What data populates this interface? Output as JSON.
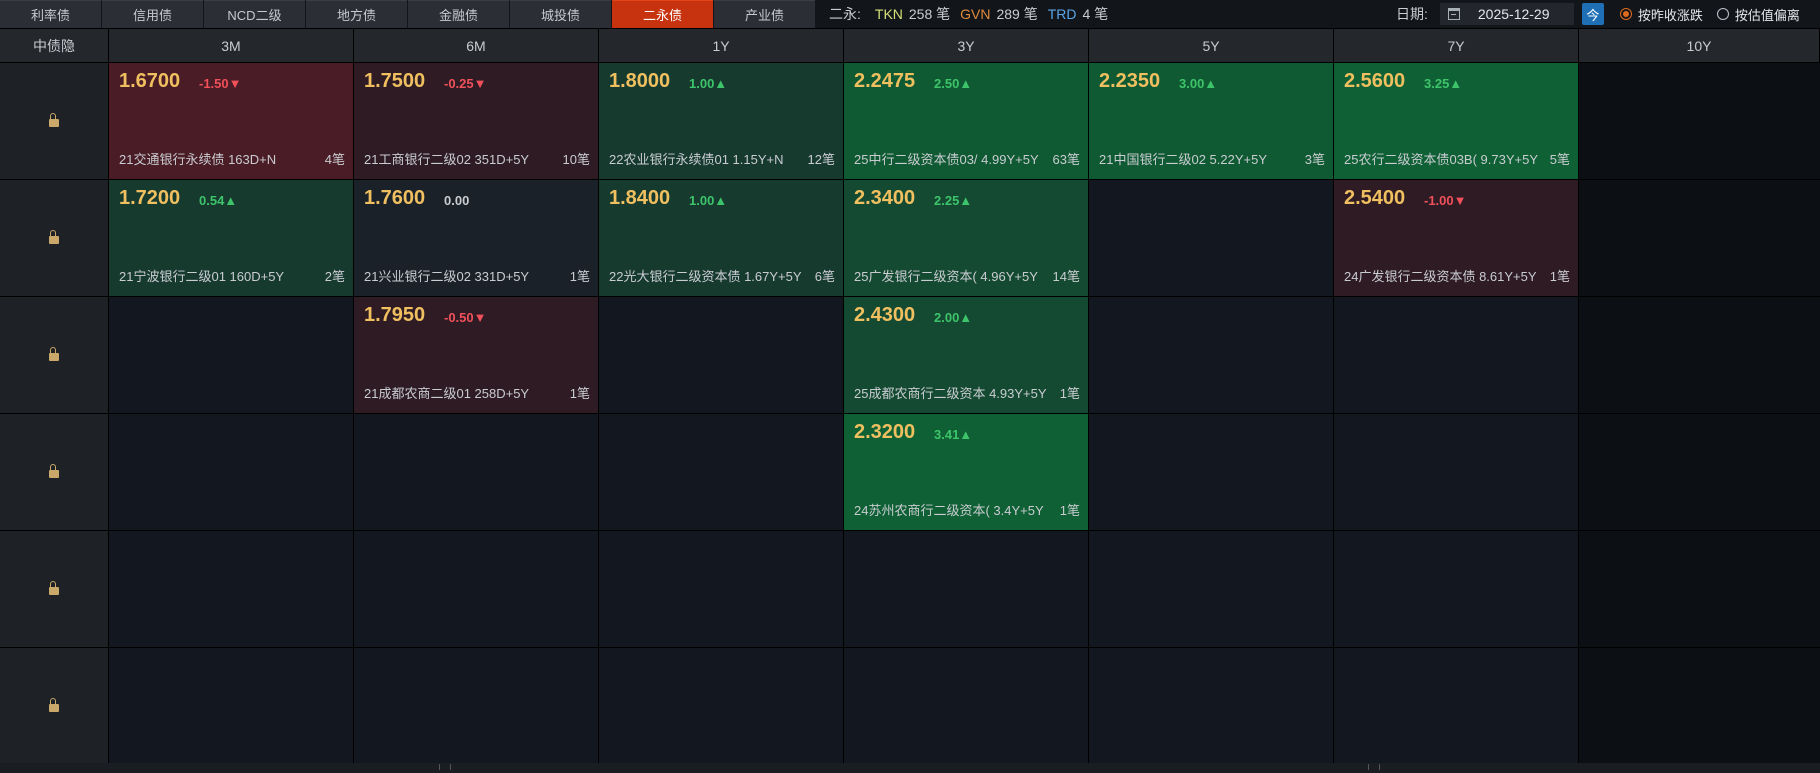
{
  "tabs": [
    "利率债",
    "信用债",
    "NCD二级",
    "地方债",
    "金融债",
    "城投债",
    "二永债",
    "产业债"
  ],
  "active_tab": 6,
  "summary": {
    "label": "二永:",
    "tkn_code": "TKN",
    "tkn_count": "258 笔",
    "gvn_code": "GVN",
    "gvn_count": "289 笔",
    "trd_code": "TRD",
    "trd_count": "4 笔"
  },
  "date": {
    "label": "日期:",
    "value": "2025-12-29",
    "today": "今"
  },
  "radios": [
    {
      "label": "按昨收涨跌",
      "selected": true
    },
    {
      "label": "按估值偏离",
      "selected": false
    }
  ],
  "colors": {
    "accent_tab": "#c8330f",
    "up": "#3dc46a",
    "down": "#f0505a",
    "yield": "#f0c060"
  },
  "headers": [
    "中债隐",
    "3M",
    "6M",
    "1Y",
    "3Y",
    "5Y",
    "7Y",
    "10Y"
  ],
  "rows": [
    [
      null,
      {
        "yield": "1.6700",
        "chg": "-1.50▼",
        "dir": "down",
        "tone": "c-red",
        "bond": "21交通银行永续债 163D+N",
        "cnt": "4笔"
      },
      {
        "yield": "1.7500",
        "chg": "-0.25▼",
        "dir": "down",
        "tone": "c-darkred",
        "bond": "21工商银行二级02 351D+5Y",
        "cnt": "10笔"
      },
      {
        "yield": "1.8000",
        "chg": "1.00▲",
        "dir": "up",
        "tone": "c-darkgreen",
        "bond": "22农业银行永续债01 1.15Y+N",
        "cnt": "12笔"
      },
      {
        "yield": "2.2475",
        "chg": "2.50▲",
        "dir": "up",
        "tone": "c-green",
        "bond": "25中行二级资本债03/ 4.99Y+5Y",
        "cnt": "63笔"
      },
      {
        "yield": "2.2350",
        "chg": "3.00▲",
        "dir": "up",
        "tone": "c-green",
        "bond": "21中国银行二级02 5.22Y+5Y",
        "cnt": "3笔"
      },
      {
        "yield": "2.5600",
        "chg": "3.25▲",
        "dir": "up",
        "tone": "c-brightgreen",
        "bond": "25农行二级资本债03B( 9.73Y+5Y",
        "cnt": "5笔"
      }
    ],
    [
      null,
      {
        "yield": "1.7200",
        "chg": "0.54▲",
        "dir": "up",
        "tone": "c-darkgreen",
        "bond": "21宁波银行二级01 160D+5Y",
        "cnt": "2笔"
      },
      {
        "yield": "1.7600",
        "chg": "0.00",
        "dir": "flat",
        "tone": "c-neutral",
        "bond": "21兴业银行二级02 331D+5Y",
        "cnt": "1笔"
      },
      {
        "yield": "1.8400",
        "chg": "1.00▲",
        "dir": "up",
        "tone": "c-darkgreen",
        "bond": "22光大银行二级资本债 1.67Y+5Y",
        "cnt": "6笔"
      },
      {
        "yield": "2.3400",
        "chg": "2.25▲",
        "dir": "up",
        "tone": "c-midgreen",
        "bond": "25广发银行二级资本( 4.96Y+5Y",
        "cnt": "14笔"
      },
      null,
      {
        "yield": "2.5400",
        "chg": "-1.00▼",
        "dir": "down",
        "tone": "c-darkred",
        "bond": "24广发银行二级资本债 8.61Y+5Y",
        "cnt": "1笔"
      }
    ],
    [
      null,
      null,
      {
        "yield": "1.7950",
        "chg": "-0.50▼",
        "dir": "down",
        "tone": "c-darkred",
        "bond": "21成都农商二级01 258D+5Y",
        "cnt": "1笔"
      },
      null,
      {
        "yield": "2.4300",
        "chg": "2.00▲",
        "dir": "up",
        "tone": "c-midgreen",
        "bond": "25成都农商行二级资本 4.93Y+5Y",
        "cnt": "1笔"
      },
      null,
      null
    ],
    [
      null,
      null,
      null,
      null,
      {
        "yield": "2.3200",
        "chg": "3.41▲",
        "dir": "up",
        "tone": "c-brightgreen",
        "bond": "24苏州农商行二级资本( 3.4Y+5Y",
        "cnt": "1笔"
      },
      null,
      null
    ],
    [
      null,
      null,
      null,
      null,
      null,
      null,
      null
    ],
    [
      null,
      null,
      null,
      null,
      null,
      null,
      null
    ]
  ]
}
